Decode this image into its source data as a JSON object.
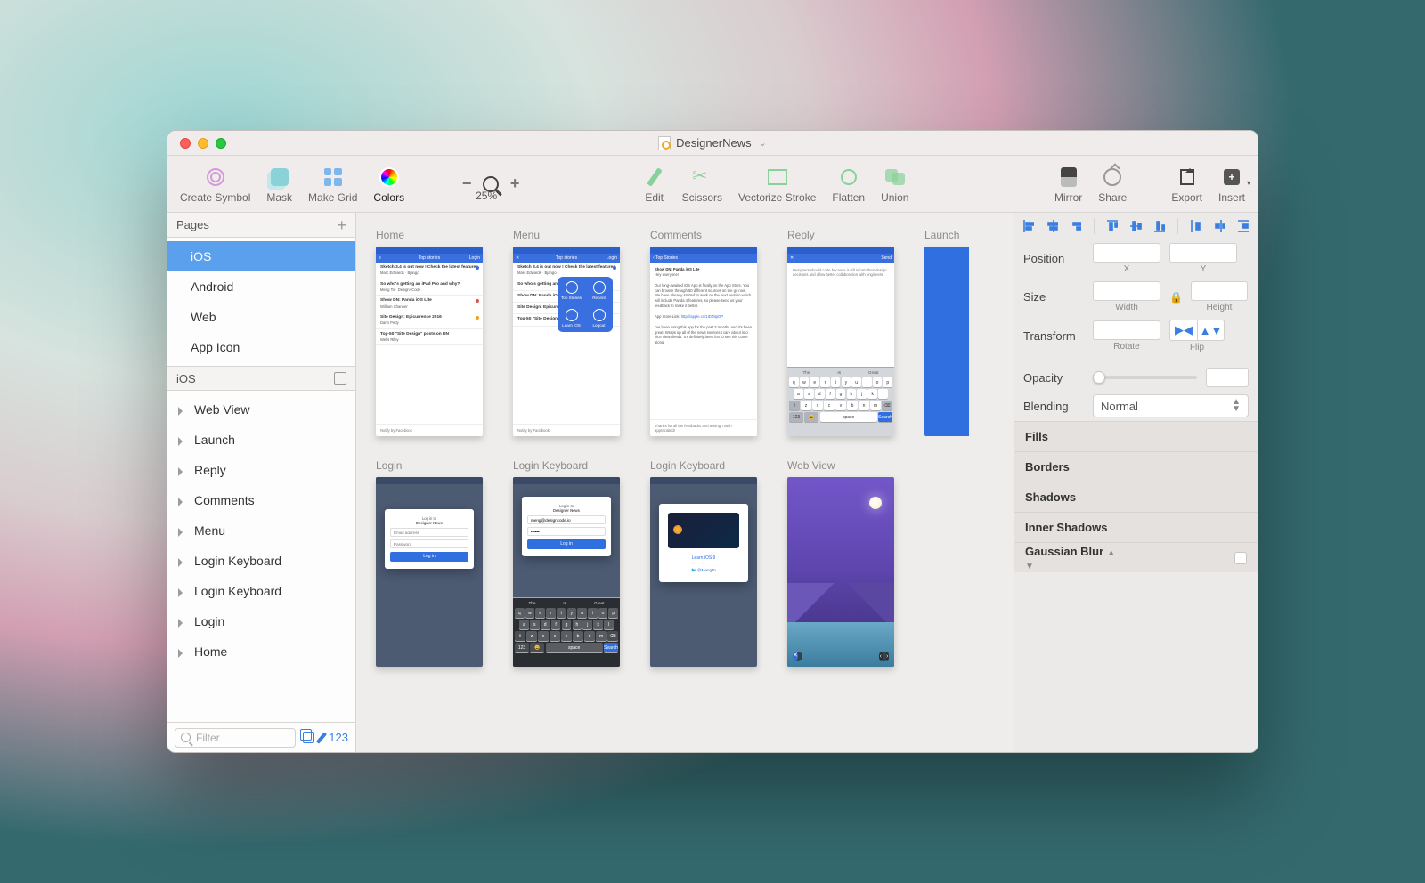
{
  "title": "DesignerNews",
  "toolbar": {
    "create_symbol": "Create Symbol",
    "mask": "Mask",
    "make_grid": "Make Grid",
    "colors": "Colors",
    "zoom_pct": "25%",
    "zoom_minus": "−",
    "zoom_plus": "+",
    "edit": "Edit",
    "scissors": "Scissors",
    "vectorize": "Vectorize Stroke",
    "flatten": "Flatten",
    "union": "Union",
    "mirror": "Mirror",
    "share": "Share",
    "export": "Export",
    "insert": "Insert"
  },
  "sidebar": {
    "pages_header": "Pages",
    "pages": [
      "iOS",
      "Android",
      "Web",
      "App Icon"
    ],
    "selected_page_index": 0,
    "artboards_header": "iOS",
    "layers": [
      "Web View",
      "Launch",
      "Reply",
      "Comments",
      "Menu",
      "Login Keyboard",
      "Login Keyboard",
      "Login",
      "Home"
    ],
    "filter_placeholder": "Filter",
    "footer_count": "123"
  },
  "canvas": {
    "artboards_row1": [
      "Home",
      "Menu",
      "Comments",
      "Reply",
      "Launch"
    ],
    "artboards_row2": [
      "Login",
      "Login Keyboard",
      "Login Keyboard",
      "Web View"
    ],
    "phone_nav": {
      "title": "Top stories",
      "left": "≡",
      "login": "Login",
      "close": "✕",
      "back": "‹ Top Stories",
      "send": "Send"
    },
    "stories": [
      {
        "title": "Sketch 3.4 is out now ! Check the latest features",
        "meta": "Marc Edwards · Bjango"
      },
      {
        "title": "So who's getting an iPad Pro and why?",
        "meta": "Meng To · Design+Code"
      },
      {
        "title": "Show DN: Panda iOS Lite",
        "meta": "William Channer"
      },
      {
        "title": "Site Design: Epicurrence 2016",
        "meta": "Dann Petty"
      },
      {
        "title": "Top-50 \"Site Design\" posts on DN",
        "meta": "Wells Riley"
      }
    ],
    "notify": "Notify by Facebook",
    "menu_items": [
      "Top Stories",
      "Recent",
      "Learn iOS",
      "Logout"
    ],
    "comment": {
      "title": "Show DN: Panda iOS Lite",
      "greet": "Hey everyone!",
      "body": "Our long-awaited iOS App is finally on the App Store. You can browse through 50 different sources on the go now. We have already started to work on the next version which will include Panda 4 features, so please send us your feedback to make it better.",
      "link_label": "App Store Link:",
      "link": "http://apple.co/1IDZ8pOP",
      "reply": "I've been using this app for the past 3 months and it's been great. Wraps up all of the news sources I care about into nice clean feeds. It's definitely been fun to see this come along.",
      "thanks": "Thanks for all the feedbacks and testing, much appreciated!"
    },
    "reply_body": "Designers should code because it will inform their design decisions and allow better collaboration with engineers.",
    "keyboard": {
      "hints": [
        "The",
        "Is",
        "Great"
      ],
      "r1": [
        "q",
        "w",
        "e",
        "r",
        "t",
        "y",
        "u",
        "i",
        "o",
        "p"
      ],
      "r2": [
        "a",
        "s",
        "d",
        "f",
        "g",
        "h",
        "j",
        "k",
        "l"
      ],
      "r3": [
        "⇧",
        "z",
        "x",
        "c",
        "v",
        "b",
        "n",
        "m",
        "⌫"
      ],
      "r4": [
        "123",
        "😀",
        "space",
        "Search"
      ]
    },
    "login": {
      "heading": "Log in to",
      "sub": "Designer News",
      "email_ph": "Email address",
      "pass_ph": "Password",
      "btn": "Log in",
      "email_val": "meng@designcode.io",
      "pass_val": "••••••"
    },
    "login_kb2": {
      "learn": "Learn iOS 9",
      "handle": "@MengTo"
    }
  },
  "inspector": {
    "position": "Position",
    "x": "X",
    "y": "Y",
    "size": "Size",
    "width": "Width",
    "height": "Height",
    "transform": "Transform",
    "rotate": "Rotate",
    "flip": "Flip",
    "opacity": "Opacity",
    "blending": "Blending",
    "blending_value": "Normal",
    "sections": [
      "Fills",
      "Borders",
      "Shadows",
      "Inner Shadows",
      "Gaussian Blur"
    ]
  }
}
